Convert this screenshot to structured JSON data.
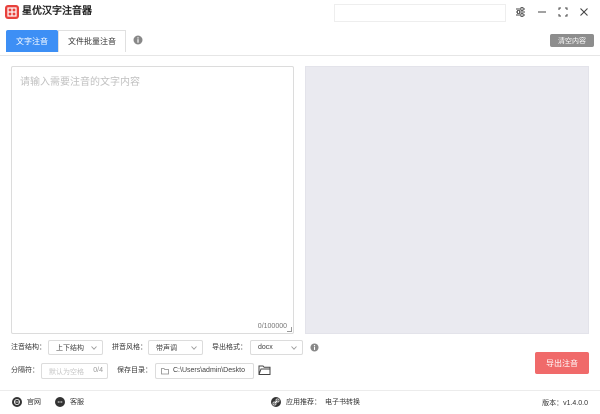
{
  "app": {
    "title": "星优汉字注音器"
  },
  "tabs": [
    {
      "label": "文字注音"
    },
    {
      "label": "文件批量注音"
    }
  ],
  "toolbar": {
    "clear_label": "清空内容"
  },
  "input": {
    "placeholder": "请输入需要注音的文字内容",
    "count": "0/100000"
  },
  "options": {
    "structure_label": "注音结构：",
    "structure_value": "上下结构",
    "pinyin_label": "拼音风格：",
    "pinyin_value": "带声调",
    "format_label": "导出格式：",
    "format_value": "docx",
    "separator_label": "分隔符：",
    "separator_placeholder": "默认为空格",
    "separator_count": "0/4",
    "dir_label": "保存目录：",
    "dir_value": "C:\\Users\\admin\\Deskto"
  },
  "actions": {
    "export_label": "导出注音"
  },
  "footer": {
    "website": "官网",
    "service": "客服",
    "recommend": "应用推荐：",
    "recommend_link": "电子书转换",
    "version_label": "版本：",
    "version_value": "v1.4.0.0"
  },
  "colors": {
    "accent": "#3d8ff5",
    "export": "#f06a6a",
    "logo": "#e8413c",
    "output_bg": "#eaeaf0"
  },
  "icons": [
    "settings-sliders-icon",
    "minimize-icon",
    "maximize-icon",
    "close-icon",
    "info-icon",
    "chevron-down-icon",
    "folder-icon",
    "open-folder-icon",
    "globe-icon",
    "chat-icon",
    "link-icon"
  ]
}
